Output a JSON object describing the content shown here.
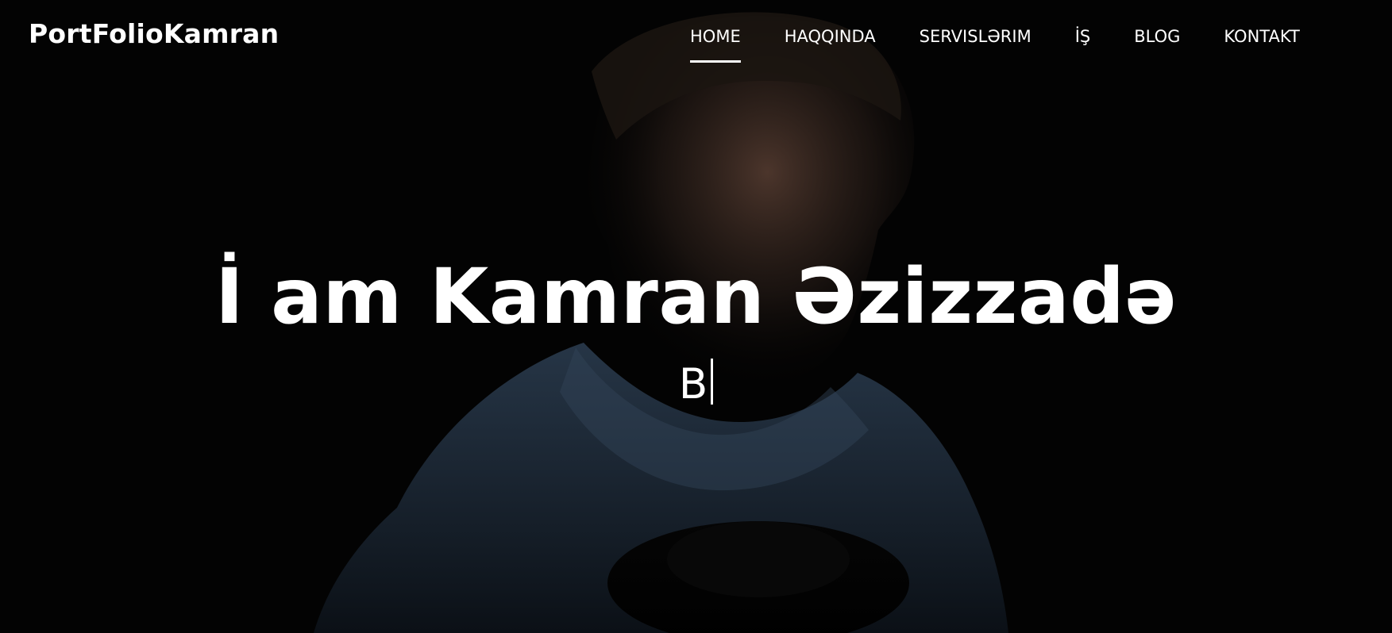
{
  "site": {
    "brand": "PortFolioKamran"
  },
  "navigation": {
    "items": [
      {
        "label": "HOME",
        "active": true
      },
      {
        "label": "HAQQINDA",
        "active": false
      },
      {
        "label": "SERVISLƏRIM",
        "active": false
      },
      {
        "label": "İŞ",
        "active": false
      },
      {
        "label": "BLOG",
        "active": false
      },
      {
        "label": "KONTAKT",
        "active": false
      }
    ]
  },
  "hero": {
    "headline": "İ am Kamran Əzizzadə",
    "typed_text": "B"
  },
  "colors": {
    "background": "#040404",
    "text": "#ffffff",
    "underline": "#ffffff"
  }
}
